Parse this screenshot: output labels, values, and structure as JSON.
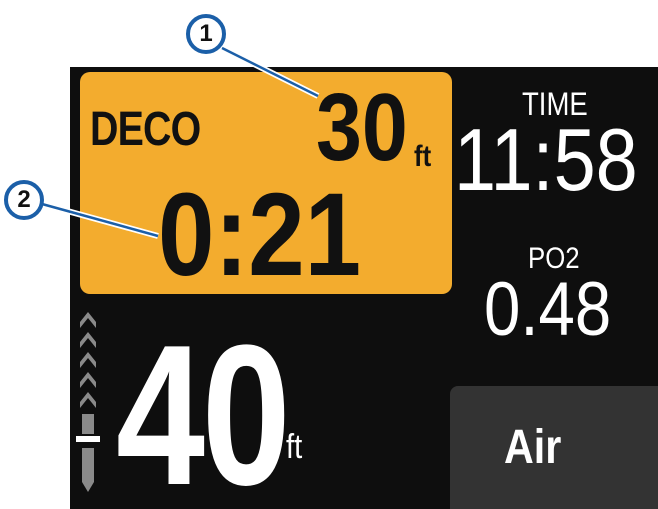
{
  "deco": {
    "label": "DECO",
    "stop_depth": "30",
    "stop_depth_unit": "ft",
    "stop_time": "0:21"
  },
  "time": {
    "label": "TIME",
    "value": "11:58"
  },
  "po2": {
    "label": "PO2",
    "value": "0.48"
  },
  "depth": {
    "value": "40",
    "unit": "ft"
  },
  "gas": {
    "label": "Air"
  },
  "callouts": {
    "one": "1",
    "two": "2"
  },
  "ascent_indicator": {
    "chevrons_up": 5
  },
  "colors": {
    "deco_panel": "#f3ac2e",
    "screen_background": "#0e0e0e",
    "gas_panel": "#333333",
    "callout_border": "#1b5fa8",
    "ascent_indicator": "#8a8a8a"
  }
}
